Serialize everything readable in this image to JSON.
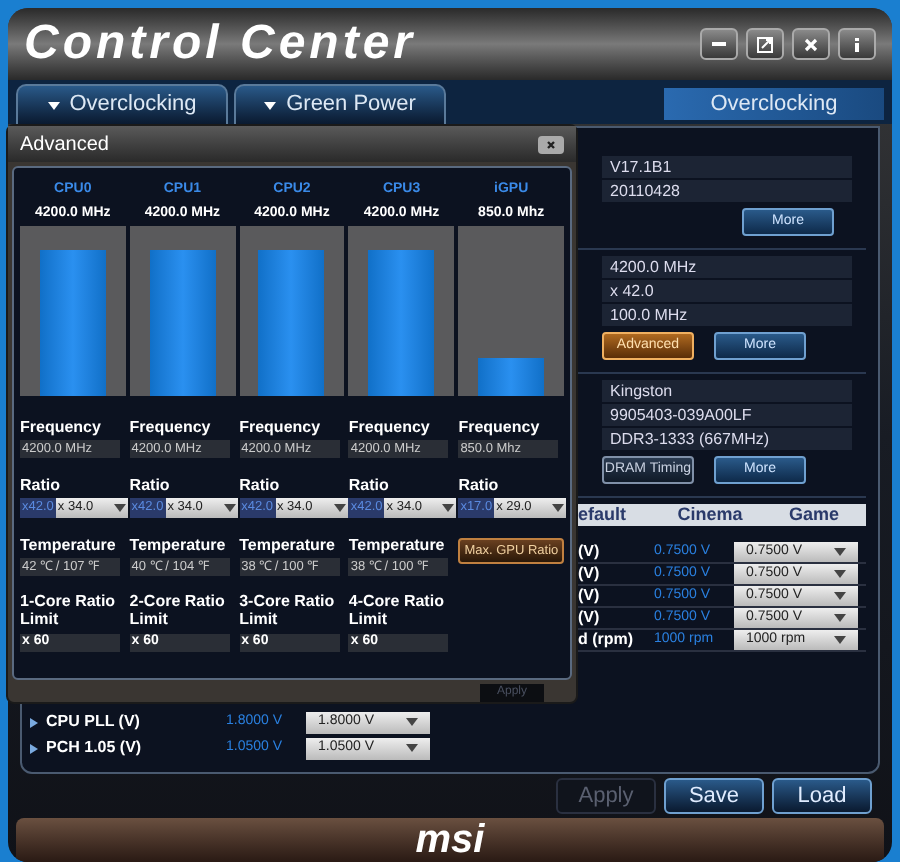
{
  "window": {
    "title": "Control Center"
  },
  "tabs": [
    {
      "label": "Overclocking"
    },
    {
      "label": "Green Power"
    }
  ],
  "section_title": "Overclocking",
  "info_sections": [
    {
      "values": [
        "V17.1B1",
        "20110428"
      ],
      "buttons": [
        {
          "label": "More",
          "kind": "blue"
        }
      ]
    },
    {
      "values": [
        "4200.0 MHz",
        "x 42.0",
        "100.0 MHz"
      ],
      "buttons": [
        {
          "label": "Advanced",
          "kind": "orange"
        },
        {
          "label": "More",
          "kind": "blue"
        }
      ]
    },
    {
      "values": [
        "Kingston",
        "9905403-039A00LF",
        "DDR3-1333 (667MHz)"
      ],
      "buttons": [
        {
          "label": "DRAM Timing",
          "kind": "gray"
        },
        {
          "label": "More",
          "kind": "blue"
        }
      ]
    }
  ],
  "profile_table": {
    "columns": [
      "efault",
      "Cinema",
      "Game"
    ],
    "rows": [
      {
        "label": "(V)",
        "cinema": "0.7500 V",
        "game": "0.7500 V"
      },
      {
        "label": "(V)",
        "cinema": "0.7500 V",
        "game": "0.7500 V"
      },
      {
        "label": "(V)",
        "cinema": "0.7500 V",
        "game": "0.7500 V"
      },
      {
        "label": "(V)",
        "cinema": "0.7500 V",
        "game": "0.7500 V"
      },
      {
        "label": "d (rpm)",
        "cinema": "1000 rpm",
        "game": "1000 rpm"
      }
    ]
  },
  "voltage_rows": [
    {
      "label": "CPU PLL (V)",
      "current": "1.8000 V",
      "setting": "1.8000 V"
    },
    {
      "label": "PCH 1.05 (V)",
      "current": "1.0500 V",
      "setting": "1.0500 V"
    }
  ],
  "buttons": [
    {
      "label": "Apply",
      "disabled": true
    },
    {
      "label": "Save",
      "disabled": false
    },
    {
      "label": "Load",
      "disabled": false
    }
  ],
  "logo": "msi",
  "advanced_dialog": {
    "title": "Advanced",
    "units": [
      {
        "name": "CPU0",
        "clock": "4200.0 MHz",
        "level": 0.86,
        "frequency_label": "Frequency",
        "frequency": "4200.0 MHz",
        "ratio_label": "Ratio",
        "ratio_current": "x42.0",
        "ratio_setting": "x 34.0",
        "temperature_label": "Temperature",
        "temperature": "42 ℃ / 107 ℉",
        "limit_label": "1-Core Ratio Limit",
        "limit": "x 60"
      },
      {
        "name": "CPU1",
        "clock": "4200.0 MHz",
        "level": 0.86,
        "frequency_label": "Frequency",
        "frequency": "4200.0 MHz",
        "ratio_label": "Ratio",
        "ratio_current": "x42.0",
        "ratio_setting": "x 34.0",
        "temperature_label": "Temperature",
        "temperature": "40 ℃ / 104 ℉",
        "limit_label": "2-Core Ratio Limit",
        "limit": "x 60"
      },
      {
        "name": "CPU2",
        "clock": "4200.0 MHz",
        "level": 0.86,
        "frequency_label": "Frequency",
        "frequency": "4200.0 MHz",
        "ratio_label": "Ratio",
        "ratio_current": "x42.0",
        "ratio_setting": "x 34.0",
        "temperature_label": "Temperature",
        "temperature": "38 ℃ / 100 ℉",
        "limit_label": "3-Core Ratio Limit",
        "limit": "x 60"
      },
      {
        "name": "CPU3",
        "clock": "4200.0 MHz",
        "level": 0.86,
        "frequency_label": "Frequency",
        "frequency": "4200.0 MHz",
        "ratio_label": "Ratio",
        "ratio_current": "x42.0",
        "ratio_setting": "x 34.0",
        "temperature_label": "Temperature",
        "temperature": "38 ℃ / 100 ℉",
        "limit_label": "4-Core Ratio Limit",
        "limit": "x 60"
      },
      {
        "name": "iGPU",
        "clock": "850.0 Mhz",
        "level": 0.22,
        "frequency_label": "Frequency",
        "frequency": "850.0 Mhz",
        "ratio_label": "Ratio",
        "ratio_current": "x17.0",
        "ratio_setting": "x 29.0",
        "button": "Max. GPU Ratio"
      }
    ],
    "apply": {
      "label": "Apply",
      "disabled": true
    }
  }
}
